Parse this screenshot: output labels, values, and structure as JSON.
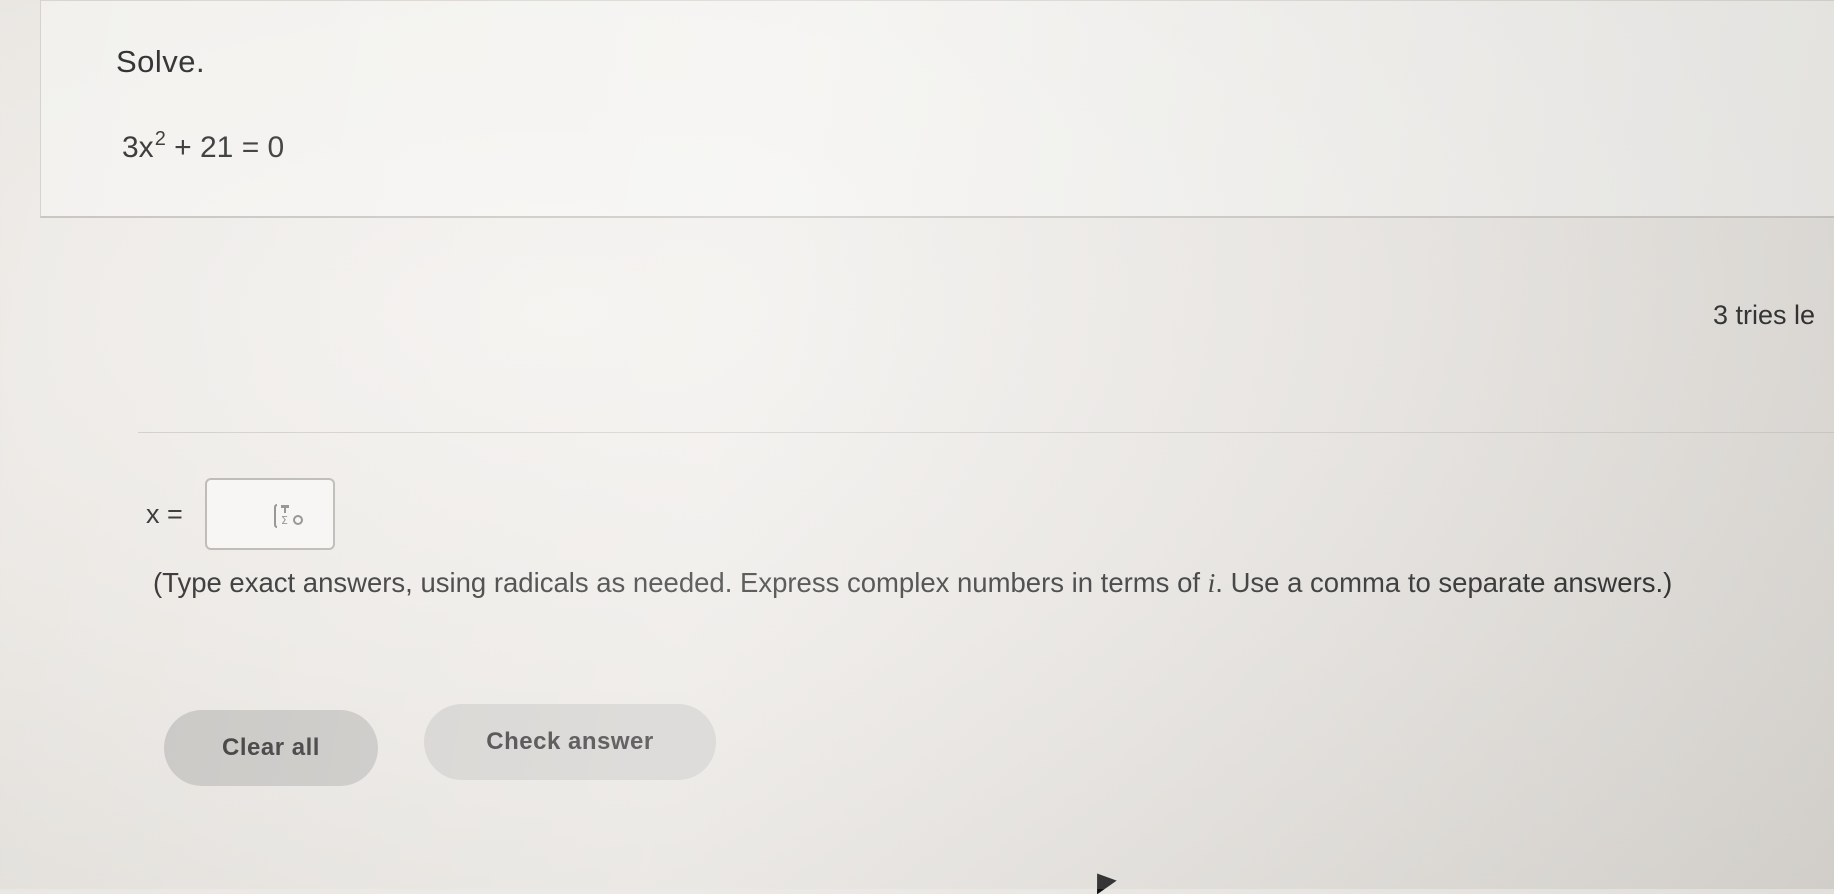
{
  "question": {
    "instruction": "Solve.",
    "equation_coefficient": "3x",
    "equation_exponent": "2",
    "equation_rest": " + 21 = 0"
  },
  "status": {
    "tries_left": "3 tries le"
  },
  "answer": {
    "variable_label": "x =",
    "value": "",
    "math_palette_icon": "math-template-icon"
  },
  "instructions_note": {
    "before_i": "(Type exact answers, using radicals as needed. Express complex numbers in terms of ",
    "i_symbol": "i",
    "after_i": ". Use a comma to separate answers.)"
  },
  "buttons": {
    "clear_all": "Clear all",
    "check_answer": "Check answer"
  }
}
